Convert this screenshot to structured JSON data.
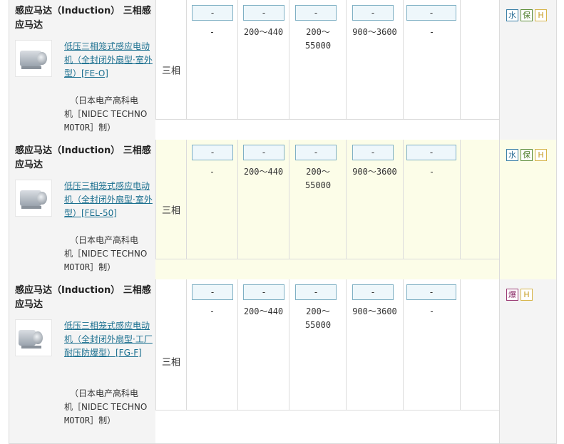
{
  "rows": [
    {
      "title": "感应马达（Induction） 三相感应马达",
      "product_link": "低压三相笼式感应电动机（全封闭外扇型·室外型）[FE-O]",
      "maker_line1": "（日本电产高科电",
      "maker_line2": "机［NIDEC TECHNO",
      "maker_line3": "MOTOR］制）",
      "phase": "三相",
      "columns": [
        {
          "button": "-",
          "value": "-"
        },
        {
          "button": "-",
          "value": "200～440"
        },
        {
          "button": "-",
          "value": "200～55000"
        },
        {
          "button": "-",
          "value": "900～3600"
        },
        {
          "button": "-",
          "value": "-"
        }
      ],
      "badges": [
        "水",
        "保",
        "H"
      ]
    },
    {
      "title": "感应马达（Induction） 三相感应马达",
      "product_link": "低压三相笼式感应电动机（全封闭外扇型·室外型）[FEL-50]",
      "maker_line1": "（日本电产高科电",
      "maker_line2": "机［NIDEC TECHNO",
      "maker_line3": "MOTOR］制）",
      "phase": "三相",
      "columns": [
        {
          "button": "-",
          "value": "-"
        },
        {
          "button": "-",
          "value": "200～440"
        },
        {
          "button": "-",
          "value": "200～55000"
        },
        {
          "button": "-",
          "value": "900～3600"
        },
        {
          "button": "-",
          "value": "-"
        }
      ],
      "badges": [
        "水",
        "保",
        "H"
      ]
    },
    {
      "title": "感应马达（Induction） 三相感应马达",
      "product_link": "低压三相笼式感应电动机（全封闭外扇型·工厂耐压防爆型）[FG-F]",
      "maker_line1": "（日本电产高科电",
      "maker_line2": "机［NIDEC TECHNO",
      "maker_line3": "MOTOR］制）",
      "phase": "三相",
      "columns": [
        {
          "button": "-",
          "value": "-"
        },
        {
          "button": "-",
          "value": "200～440"
        },
        {
          "button": "-",
          "value": "200～55000"
        },
        {
          "button": "-",
          "value": "900～3600"
        },
        {
          "button": "-",
          "value": "-"
        }
      ],
      "badges": [
        "爆",
        "H"
      ]
    }
  ]
}
